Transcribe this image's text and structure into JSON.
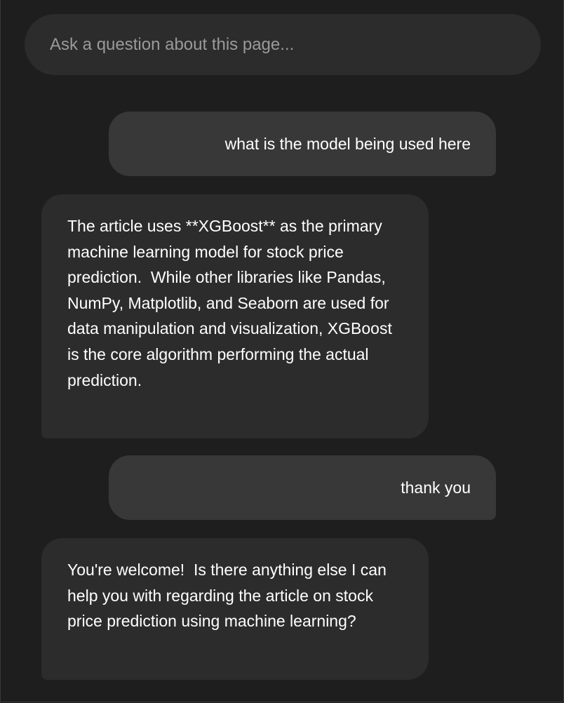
{
  "search": {
    "placeholder": "Ask a question about this page..."
  },
  "conversation": {
    "messages": [
      {
        "role": "user",
        "text": "what is the model being used here"
      },
      {
        "role": "assistant",
        "text": "The article uses **XGBoost** as the primary machine learning model for stock price prediction.  While other libraries like Pandas, NumPy, Matplotlib, and Seaborn are used for data manipulation and visualization, XGBoost is the core algorithm performing the actual prediction."
      },
      {
        "role": "user",
        "text": "thank you"
      },
      {
        "role": "assistant",
        "text": "You're welcome!  Is there anything else I can help you with regarding the article on stock price prediction using machine learning?"
      }
    ]
  },
  "colors": {
    "background": "#1e1e1e",
    "input_background": "#2c2c2c",
    "user_bubble": "#383838",
    "assistant_bubble": "#2c2c2c",
    "text": "#ffffff",
    "placeholder": "#9a9a9a"
  }
}
